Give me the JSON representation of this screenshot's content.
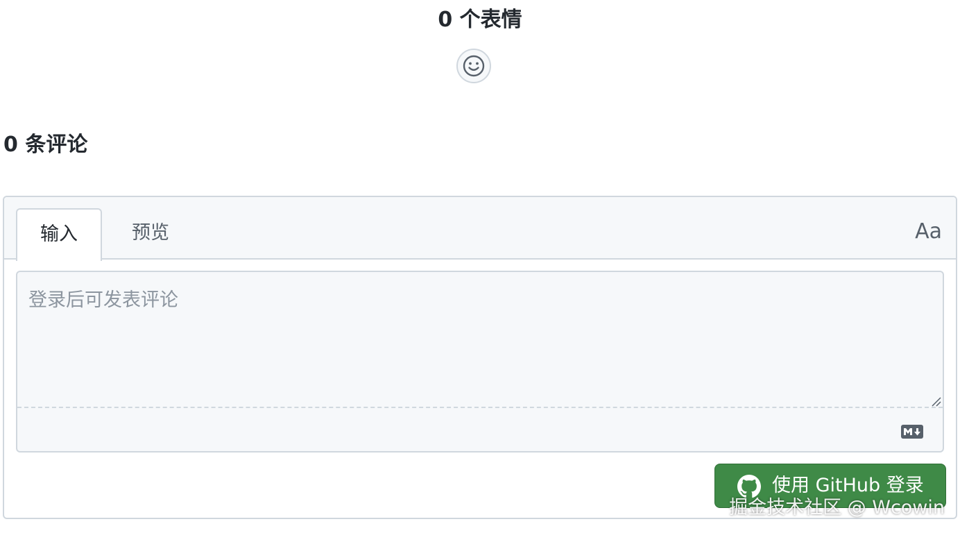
{
  "reactions": {
    "header": "0 个表情",
    "add_reaction_icon": "smiley-icon"
  },
  "comments": {
    "count_label": "0 条评论"
  },
  "editor": {
    "tabs": [
      {
        "label": "输入",
        "active": true
      },
      {
        "label": "预览",
        "active": false
      }
    ],
    "font_toggle_label": "Aa",
    "textarea_value": "",
    "textarea_placeholder": "登录后可发表评论",
    "markdown_icon": "markdown-icon"
  },
  "login_button": {
    "label": "使用 GitHub 登录",
    "icon": "github-icon",
    "color": "#3f8a47"
  },
  "watermark": "掘金技术社区 @ Wcowin"
}
